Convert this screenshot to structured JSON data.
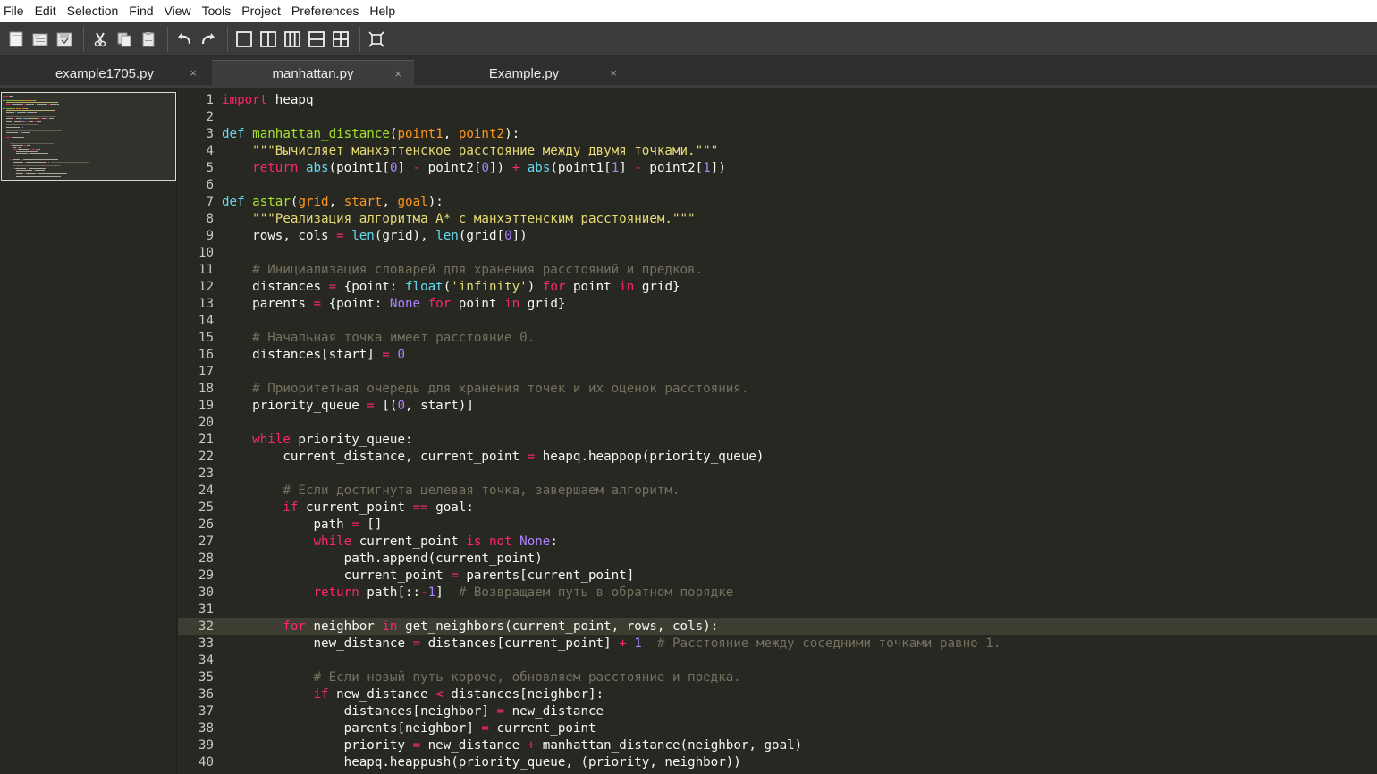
{
  "menu": [
    "File",
    "Edit",
    "Selection",
    "Find",
    "View",
    "Tools",
    "Project",
    "Preferences",
    "Help"
  ],
  "toolbar": {
    "groups": [
      [
        "new-file-icon",
        "open-file-icon",
        "save-file-icon"
      ],
      [
        "cut-icon",
        "copy-icon",
        "paste-icon"
      ],
      [
        "undo-icon",
        "redo-icon"
      ],
      [
        "layout-single-icon",
        "layout-two-columns-icon",
        "layout-three-columns-icon",
        "layout-two-rows-icon",
        "layout-grid-icon"
      ],
      [
        "fullscreen-icon"
      ]
    ]
  },
  "tabs": [
    {
      "label": "example1705.py",
      "active": false,
      "close": "×"
    },
    {
      "label": "manhattan.py",
      "active": true,
      "close": "×"
    },
    {
      "label": "Example.py",
      "active": false,
      "close": "×"
    }
  ],
  "editor": {
    "current_line": 32,
    "lines": [
      [
        [
          "kw",
          "import"
        ],
        [
          "t",
          " heapq"
        ]
      ],
      [],
      [
        [
          "df",
          "def"
        ],
        [
          "t",
          " "
        ],
        [
          "fn",
          "manhattan_distance"
        ],
        [
          "t",
          "("
        ],
        [
          "arg",
          "point1"
        ],
        [
          "t",
          ", "
        ],
        [
          "arg",
          "point2"
        ],
        [
          "t",
          "):"
        ]
      ],
      [
        [
          "t",
          "    "
        ],
        [
          "str",
          "\"\"\"Вычисляет манхэттенское расстояние между двумя точками.\"\"\""
        ]
      ],
      [
        [
          "t",
          "    "
        ],
        [
          "kw",
          "return"
        ],
        [
          "t",
          " "
        ],
        [
          "bi",
          "abs"
        ],
        [
          "t",
          "(point1["
        ],
        [
          "num",
          "0"
        ],
        [
          "t",
          "] "
        ],
        [
          "op",
          "-"
        ],
        [
          "t",
          " point2["
        ],
        [
          "num",
          "0"
        ],
        [
          "t",
          "]) "
        ],
        [
          "op",
          "+"
        ],
        [
          "t",
          " "
        ],
        [
          "bi",
          "abs"
        ],
        [
          "t",
          "(point1["
        ],
        [
          "num",
          "1"
        ],
        [
          "t",
          "] "
        ],
        [
          "op",
          "-"
        ],
        [
          "t",
          " point2["
        ],
        [
          "num",
          "1"
        ],
        [
          "t",
          "])"
        ]
      ],
      [],
      [
        [
          "df",
          "def"
        ],
        [
          "t",
          " "
        ],
        [
          "fn",
          "astar"
        ],
        [
          "t",
          "("
        ],
        [
          "arg",
          "grid"
        ],
        [
          "t",
          ", "
        ],
        [
          "arg",
          "start"
        ],
        [
          "t",
          ", "
        ],
        [
          "arg",
          "goal"
        ],
        [
          "t",
          "):"
        ]
      ],
      [
        [
          "t",
          "    "
        ],
        [
          "str",
          "\"\"\"Реализация алгоритма A* с манхэттенским расстоянием.\"\"\""
        ]
      ],
      [
        [
          "t",
          "    rows, cols "
        ],
        [
          "op",
          "="
        ],
        [
          "t",
          " "
        ],
        [
          "bi",
          "len"
        ],
        [
          "t",
          "(grid), "
        ],
        [
          "bi",
          "len"
        ],
        [
          "t",
          "(grid["
        ],
        [
          "num",
          "0"
        ],
        [
          "t",
          "])"
        ]
      ],
      [],
      [
        [
          "t",
          "    "
        ],
        [
          "cm",
          "# Инициализация словарей для хранения расстояний и предков."
        ]
      ],
      [
        [
          "t",
          "    distances "
        ],
        [
          "op",
          "="
        ],
        [
          "t",
          " {point: "
        ],
        [
          "bi",
          "float"
        ],
        [
          "t",
          "("
        ],
        [
          "str",
          "'infinity'"
        ],
        [
          "t",
          ") "
        ],
        [
          "kw",
          "for"
        ],
        [
          "t",
          " point "
        ],
        [
          "kw",
          "in"
        ],
        [
          "t",
          " grid}"
        ]
      ],
      [
        [
          "t",
          "    parents "
        ],
        [
          "op",
          "="
        ],
        [
          "t",
          " {point: "
        ],
        [
          "num",
          "None"
        ],
        [
          "t",
          " "
        ],
        [
          "kw",
          "for"
        ],
        [
          "t",
          " point "
        ],
        [
          "kw",
          "in"
        ],
        [
          "t",
          " grid}"
        ]
      ],
      [],
      [
        [
          "t",
          "    "
        ],
        [
          "cm",
          "# Начальная точка имеет расстояние 0."
        ]
      ],
      [
        [
          "t",
          "    distances[start] "
        ],
        [
          "op",
          "="
        ],
        [
          "t",
          " "
        ],
        [
          "num",
          "0"
        ]
      ],
      [],
      [
        [
          "t",
          "    "
        ],
        [
          "cm",
          "# Приоритетная очередь для хранения точек и их оценок расстояния."
        ]
      ],
      [
        [
          "t",
          "    priority_queue "
        ],
        [
          "op",
          "="
        ],
        [
          "t",
          " [("
        ],
        [
          "num",
          "0"
        ],
        [
          "t",
          ", start)]"
        ]
      ],
      [],
      [
        [
          "t",
          "    "
        ],
        [
          "kw",
          "while"
        ],
        [
          "t",
          " priority_queue:"
        ]
      ],
      [
        [
          "t",
          "        current_distance, current_point "
        ],
        [
          "op",
          "="
        ],
        [
          "t",
          " heapq.heappop(priority_queue)"
        ]
      ],
      [],
      [
        [
          "t",
          "        "
        ],
        [
          "cm",
          "# Если достигнута целевая точка, завершаем алгоритм."
        ]
      ],
      [
        [
          "t",
          "        "
        ],
        [
          "kw",
          "if"
        ],
        [
          "t",
          " current_point "
        ],
        [
          "op",
          "=="
        ],
        [
          "t",
          " goal:"
        ]
      ],
      [
        [
          "t",
          "            path "
        ],
        [
          "op",
          "="
        ],
        [
          "t",
          " []"
        ]
      ],
      [
        [
          "t",
          "            "
        ],
        [
          "kw",
          "while"
        ],
        [
          "t",
          " current_point "
        ],
        [
          "kw",
          "is"
        ],
        [
          "t",
          " "
        ],
        [
          "kw",
          "not"
        ],
        [
          "t",
          " "
        ],
        [
          "num",
          "None"
        ],
        [
          "t",
          ":"
        ]
      ],
      [
        [
          "t",
          "                path.append(current_point)"
        ]
      ],
      [
        [
          "t",
          "                current_point "
        ],
        [
          "op",
          "="
        ],
        [
          "t",
          " parents[current_point]"
        ]
      ],
      [
        [
          "t",
          "            "
        ],
        [
          "kw",
          "return"
        ],
        [
          "t",
          " path[::"
        ],
        [
          "op",
          "-"
        ],
        [
          "num",
          "1"
        ],
        [
          "t",
          "]  "
        ],
        [
          "cm",
          "# Возвращаем путь в обратном порядке"
        ]
      ],
      [],
      [
        [
          "t",
          "        "
        ],
        [
          "kw",
          "for"
        ],
        [
          "t",
          " neighbor "
        ],
        [
          "kw",
          "in"
        ],
        [
          "t",
          " get_neighbors(current_point, rows, cols):"
        ]
      ],
      [
        [
          "t",
          "            new_distance "
        ],
        [
          "op",
          "="
        ],
        [
          "t",
          " distances[current_point] "
        ],
        [
          "op",
          "+"
        ],
        [
          "t",
          " "
        ],
        [
          "num",
          "1"
        ],
        [
          "t",
          "  "
        ],
        [
          "cm",
          "# Расстояние между соседними точками равно 1."
        ]
      ],
      [],
      [
        [
          "t",
          "            "
        ],
        [
          "cm",
          "# Если новый путь короче, обновляем расстояние и предка."
        ]
      ],
      [
        [
          "t",
          "            "
        ],
        [
          "kw",
          "if"
        ],
        [
          "t",
          " new_distance "
        ],
        [
          "op",
          "<"
        ],
        [
          "t",
          " distances[neighbor]:"
        ]
      ],
      [
        [
          "t",
          "                distances[neighbor] "
        ],
        [
          "op",
          "="
        ],
        [
          "t",
          " new_distance"
        ]
      ],
      [
        [
          "t",
          "                parents[neighbor] "
        ],
        [
          "op",
          "="
        ],
        [
          "t",
          " current_point"
        ]
      ],
      [
        [
          "t",
          "                priority "
        ],
        [
          "op",
          "="
        ],
        [
          "t",
          " new_distance "
        ],
        [
          "op",
          "+"
        ],
        [
          "t",
          " manhattan_distance(neighbor, goal)"
        ]
      ],
      [
        [
          "t",
          "                heapq.heappush(priority_queue, (priority, neighbor))"
        ]
      ]
    ]
  }
}
